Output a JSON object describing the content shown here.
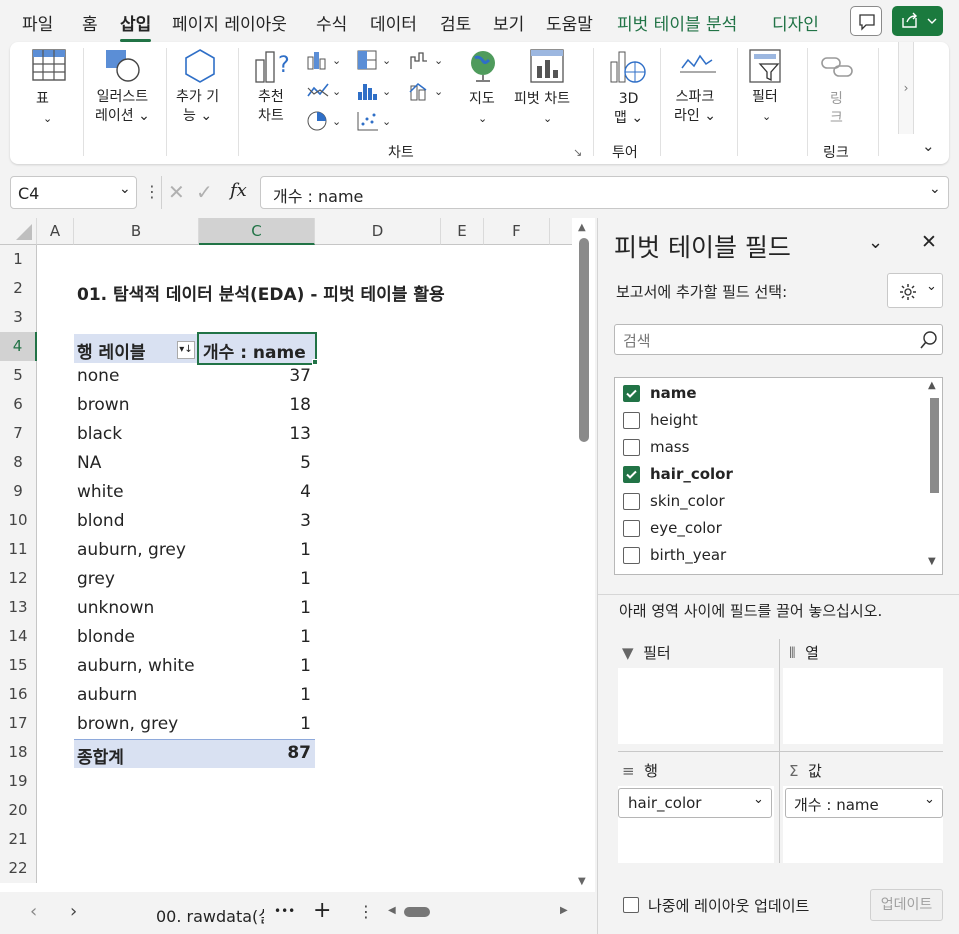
{
  "ribbon_tabs": [
    {
      "label": "파일",
      "active": false
    },
    {
      "label": "홈",
      "active": false
    },
    {
      "label": "삽입",
      "active": true
    },
    {
      "label": "페이지 레이아웃",
      "active": false
    },
    {
      "label": "수식",
      "active": false
    },
    {
      "label": "데이터",
      "active": false
    },
    {
      "label": "검토",
      "active": false
    },
    {
      "label": "보기",
      "active": false
    },
    {
      "label": "도움말",
      "active": false
    },
    {
      "label": "피벗 테이블 분석",
      "active": false
    },
    {
      "label": "디자인",
      "active": false
    }
  ],
  "ribbon": {
    "table_l1": "표",
    "illus_l1": "일러스트",
    "illus_l2": "레이션",
    "addin_l1": "추가 기",
    "addin_l2": "능",
    "recchart_l1": "추천",
    "recchart_l2": "차트",
    "map_label": "지도",
    "pivotchart_label": "피벗 차트",
    "map3d_l1": "3D",
    "map3d_l2": "맵",
    "spark_l1": "스파크",
    "spark_l2": "라인",
    "filter_label": "필터",
    "link_l1": "링",
    "link_l2": "크",
    "group_chart": "차트",
    "group_tour": "투어",
    "group_link": "링크"
  },
  "formula_bar": {
    "name_box": "C4",
    "fx": "fx",
    "formula": "개수 : name"
  },
  "columns": [
    "A",
    "B",
    "C",
    "D",
    "E",
    "F"
  ],
  "rows": [
    "1",
    "2",
    "3",
    "4",
    "5",
    "6",
    "7",
    "8",
    "9",
    "10",
    "11",
    "12",
    "13",
    "14",
    "15",
    "16",
    "17",
    "18",
    "19",
    "20",
    "21",
    "22"
  ],
  "sheet": {
    "title": "01. 탐색적 데이터 분석(EDA) - 피벗 테이블 활용",
    "header_row_label": "행 레이블",
    "header_value": "개수 : name",
    "data": [
      {
        "label": "none",
        "value": "37"
      },
      {
        "label": "brown",
        "value": "18"
      },
      {
        "label": "black",
        "value": "13"
      },
      {
        "label": "NA",
        "value": "5"
      },
      {
        "label": "white",
        "value": "4"
      },
      {
        "label": "blond",
        "value": "3"
      },
      {
        "label": "auburn, grey",
        "value": "1"
      },
      {
        "label": "grey",
        "value": "1"
      },
      {
        "label": "unknown",
        "value": "1"
      },
      {
        "label": "blonde",
        "value": "1"
      },
      {
        "label": "auburn, white",
        "value": "1"
      },
      {
        "label": "auburn",
        "value": "1"
      },
      {
        "label": "brown, grey",
        "value": "1"
      }
    ],
    "total_label": "종합계",
    "total_value": "87"
  },
  "sheet_tabs": {
    "tab_name": "00. rawdata(실",
    "more": "•••",
    "add": "+"
  },
  "pivot_pane": {
    "title": "피벗 테이블 필드",
    "subtitle": "보고서에 추가할 필드 선택:",
    "search_placeholder": "검색",
    "fields": [
      {
        "name": "name",
        "checked": true
      },
      {
        "name": "height",
        "checked": false
      },
      {
        "name": "mass",
        "checked": false
      },
      {
        "name": "hair_color",
        "checked": true
      },
      {
        "name": "skin_color",
        "checked": false
      },
      {
        "name": "eye_color",
        "checked": false
      },
      {
        "name": "birth_year",
        "checked": false
      }
    ],
    "drag_hint": "아래 영역 사이에 필드를 끌어 놓으십시오.",
    "zone_filter": "필터",
    "zone_columns": "열",
    "zone_rows": "행",
    "zone_values": "값",
    "rows_field": "hair_color",
    "values_field": "개수 : name",
    "defer_label": "나중에 레이아웃 업데이트",
    "update_button": "업데이트"
  },
  "colors": {
    "accent": "#217346",
    "pivot_header": "#d9e1f2",
    "share": "#1b7a3e"
  }
}
